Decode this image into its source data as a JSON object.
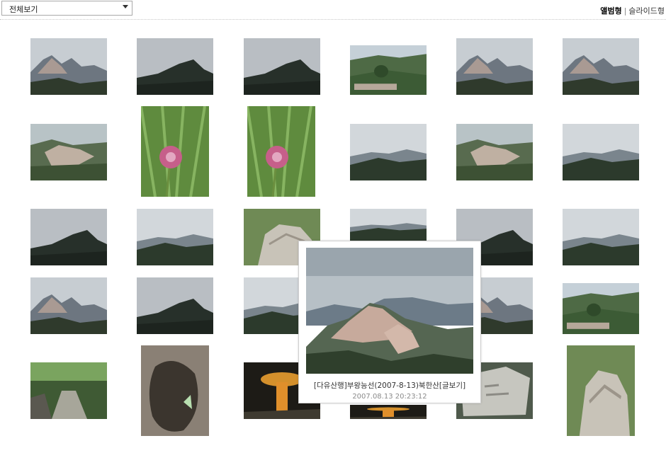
{
  "filter": {
    "selected": "전체보기"
  },
  "view_modes": {
    "active": "앨범형",
    "separator": "|",
    "other": "슬라이드형"
  },
  "popup": {
    "title": "[다유산행]부왕능선(2007-8-13)북한산",
    "comment_link": "[글보기]",
    "date": "2007.08.13 20:23:12"
  },
  "thumbnails": [
    {
      "name": "photo-mountain-ridge-1",
      "scene": "peaks"
    },
    {
      "name": "photo-mountain-ridge-2",
      "scene": "dark"
    },
    {
      "name": "photo-mountain-ridge-3",
      "scene": "dark"
    },
    {
      "name": "photo-pine-valley",
      "scene": "green"
    },
    {
      "name": "photo-mountain-ridge-4",
      "scene": "peaks"
    },
    {
      "name": "photo-mountain-ridge-5",
      "scene": "peaks"
    },
    {
      "name": "photo-rocky-slope",
      "scene": "rock"
    },
    {
      "name": "photo-pink-flower-1",
      "scene": "flower"
    },
    {
      "name": "photo-pink-flower-2",
      "scene": "flower"
    },
    {
      "name": "photo-distant-valley",
      "scene": "haze"
    },
    {
      "name": "photo-rock-peaks",
      "scene": "rock"
    },
    {
      "name": "photo-pine-peak",
      "scene": "haze"
    },
    {
      "name": "photo-cloudy-ridge-1",
      "scene": "dark"
    },
    {
      "name": "photo-cloudy-ridge-2",
      "scene": "haze"
    },
    {
      "name": "photo-boulder",
      "scene": "boulder"
    },
    {
      "name": "photo-cloudy-ridge-3",
      "scene": "haze"
    },
    {
      "name": "photo-cloudy-ridge-4",
      "scene": "dark"
    },
    {
      "name": "photo-cloudy-ridge-5",
      "scene": "haze"
    },
    {
      "name": "photo-granite-peak-1",
      "scene": "peaks"
    },
    {
      "name": "photo-granite-peak-2",
      "scene": "dark"
    },
    {
      "name": "photo-granite-peak-3",
      "scene": "haze"
    },
    {
      "name": "photo-granite-peak-4",
      "scene": "peaks"
    },
    {
      "name": "photo-forest-hill",
      "scene": "green"
    },
    {
      "name": "photo-stream",
      "scene": "stream"
    },
    {
      "name": "photo-cave-rock",
      "scene": "cave"
    },
    {
      "name": "photo-orange-mushroom",
      "scene": "mushroom"
    },
    {
      "name": "photo-mushroom-2",
      "scene": "mushroom"
    },
    {
      "name": "photo-carved-rock",
      "scene": "stone"
    },
    {
      "name": "photo-mossy-boulder",
      "scene": "boulder"
    }
  ],
  "colors": {
    "sky": "#c9ced3",
    "mountain": "#59616a",
    "forest": "#2d3b2a",
    "rock": "#b79c91"
  }
}
